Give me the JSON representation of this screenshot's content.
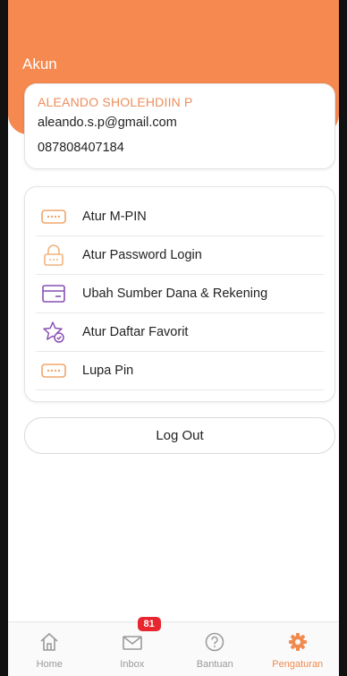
{
  "header": {
    "title": "Akun"
  },
  "account": {
    "name": "ALEANDO SHOLEHDIIN P",
    "email": "aleando.s.p@gmail.com",
    "phone": "087808407184"
  },
  "menu": {
    "items": [
      {
        "label": "Atur M-PIN",
        "icon": "pin-keypad-icon"
      },
      {
        "label": "Atur Password Login",
        "icon": "lock-icon"
      },
      {
        "label": "Ubah Sumber Dana & Rekening",
        "icon": "card-icon"
      },
      {
        "label": "Atur Daftar Favorit",
        "icon": "star-check-icon"
      },
      {
        "label": "Lupa Pin",
        "icon": "pin-keypad-icon"
      }
    ]
  },
  "logout": {
    "label": "Log Out"
  },
  "nav": {
    "items": [
      {
        "label": "Home",
        "icon": "home-icon"
      },
      {
        "label": "Inbox",
        "icon": "mail-icon",
        "badge": "81"
      },
      {
        "label": "Bantuan",
        "icon": "help-icon"
      },
      {
        "label": "Pengaturan",
        "icon": "gear-icon",
        "active": true
      }
    ]
  },
  "colors": {
    "accent": "#f5894f",
    "icon_orange": "#f0b47c",
    "icon_purple": "#8a4fb3",
    "badge": "#e8262f"
  }
}
